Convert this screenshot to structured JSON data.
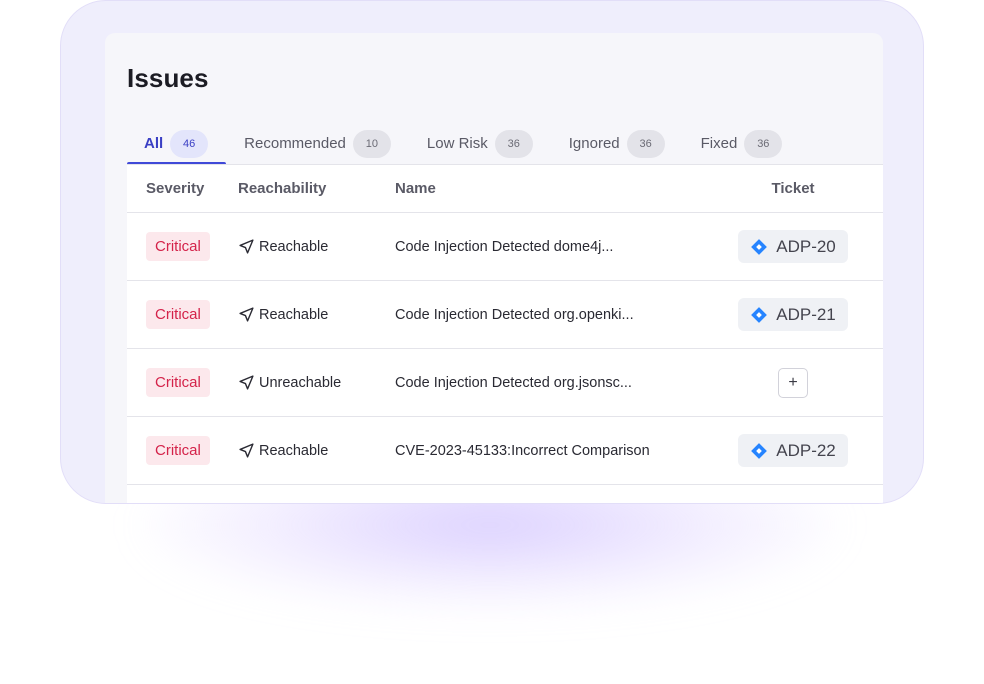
{
  "page": {
    "title": "Issues"
  },
  "tabs": [
    {
      "label": "All",
      "count": "46",
      "active": true
    },
    {
      "label": "Recommended",
      "count": "10",
      "active": false
    },
    {
      "label": "Low Risk",
      "count": "36",
      "active": false
    },
    {
      "label": "Ignored",
      "count": "36",
      "active": false
    },
    {
      "label": "Fixed",
      "count": "36",
      "active": false
    }
  ],
  "table": {
    "headers": {
      "severity": "Severity",
      "reachability": "Reachability",
      "name": "Name",
      "ticket": "Ticket"
    },
    "rows": [
      {
        "severity": "Critical",
        "reachability": "Reachable",
        "name": "Code Injection Detected dome4j...",
        "ticket": "ADP-20"
      },
      {
        "severity": "Critical",
        "reachability": "Reachable",
        "name": "Code Injection Detected org.openki...",
        "ticket": "ADP-21"
      },
      {
        "severity": "Critical",
        "reachability": "Unreachable",
        "name": "Code Injection Detected org.jsonsc...",
        "ticket": "+"
      },
      {
        "severity": "Critical",
        "reachability": "Reachable",
        "name": "CVE-2023-45133:Incorrect Comparison",
        "ticket": "ADP-22"
      }
    ]
  },
  "colors": {
    "accent": "#4049d8",
    "critical_text": "#d4234a",
    "critical_bg": "#fce8ec",
    "jira_blue": "#2684ff",
    "frame_bg": "#efeefc"
  },
  "icons": {
    "reachability": "navigation-arrow-icon",
    "ticket": "jira-icon",
    "add_ticket": "plus-icon"
  }
}
